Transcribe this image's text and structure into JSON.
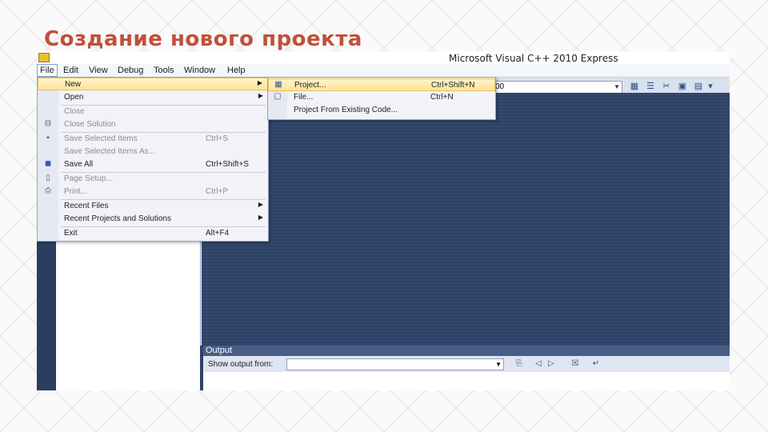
{
  "slide": {
    "title": "Создание нового проекта"
  },
  "window": {
    "title": "Microsoft Visual C++ 2010 Express"
  },
  "menubar": {
    "items": [
      {
        "label": "File"
      },
      {
        "label": "Edit"
      },
      {
        "label": "View"
      },
      {
        "label": "Debug"
      },
      {
        "label": "Tools"
      },
      {
        "label": "Window"
      },
      {
        "label": "Help"
      }
    ]
  },
  "toolbar": {
    "config_value": "00",
    "icons": [
      "solution-explorer-icon",
      "properties-icon",
      "toolbox-icon",
      "extension-icon",
      "class-view-icon",
      "overflow-icon"
    ]
  },
  "file_menu": {
    "items": [
      {
        "label": "New",
        "shortcut": "",
        "submenu": true,
        "disabled": false,
        "icon": ""
      },
      {
        "label": "Open",
        "shortcut": "",
        "submenu": true,
        "disabled": false,
        "icon": ""
      },
      {
        "label": "Close",
        "shortcut": "",
        "submenu": false,
        "disabled": true,
        "icon": ""
      },
      {
        "label": "Close Solution",
        "shortcut": "",
        "submenu": false,
        "disabled": true,
        "icon": "close-solution-icon"
      },
      {
        "label": "Save Selected Items",
        "shortcut": "Ctrl+S",
        "submenu": false,
        "disabled": true,
        "icon": "save-icon"
      },
      {
        "label": "Save Selected Items As...",
        "shortcut": "",
        "submenu": false,
        "disabled": true,
        "icon": ""
      },
      {
        "label": "Save All",
        "shortcut": "Ctrl+Shift+S",
        "submenu": false,
        "disabled": false,
        "icon": "save-all-icon"
      },
      {
        "label": "Page Setup...",
        "shortcut": "",
        "submenu": false,
        "disabled": true,
        "icon": "page-setup-icon"
      },
      {
        "label": "Print...",
        "shortcut": "Ctrl+P",
        "submenu": false,
        "disabled": true,
        "icon": "print-icon"
      },
      {
        "label": "Recent Files",
        "shortcut": "",
        "submenu": true,
        "disabled": false,
        "icon": ""
      },
      {
        "label": "Recent Projects and Solutions",
        "shortcut": "",
        "submenu": true,
        "disabled": false,
        "icon": ""
      },
      {
        "label": "Exit",
        "shortcut": "Alt+F4",
        "submenu": false,
        "disabled": false,
        "icon": ""
      }
    ]
  },
  "new_submenu": {
    "items": [
      {
        "label": "Project...",
        "shortcut": "Ctrl+Shift+N",
        "icon": "new-project-icon"
      },
      {
        "label": "File...",
        "shortcut": "Ctrl+N",
        "icon": "new-file-icon"
      },
      {
        "label": "Project From Existing Code...",
        "shortcut": "",
        "icon": ""
      }
    ]
  },
  "output": {
    "title": "Output",
    "show_from_label": "Show output from:",
    "show_from_value": "",
    "icons": [
      "find-message-icon",
      "prev-message-icon",
      "next-message-icon",
      "clear-all-icon",
      "word-wrap-icon"
    ]
  },
  "colors": {
    "title": "#c0503a",
    "ide_background": "#2f4367",
    "menu_highlight": "#fde39a"
  }
}
